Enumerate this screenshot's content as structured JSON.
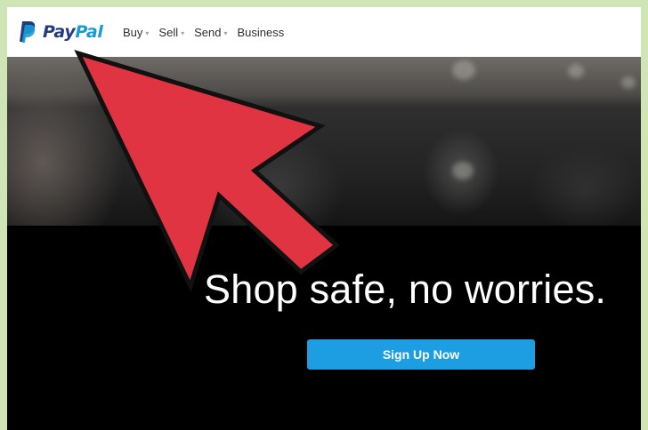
{
  "brand": {
    "logo_part1": "Pay",
    "logo_part2": "Pal",
    "logo_icon": "paypal-p-icon",
    "colors": {
      "pay": "#253b80",
      "pal": "#179bd7",
      "accent_button": "#1d9ee2",
      "annotation_arrow": "#e03442"
    }
  },
  "nav": {
    "items": [
      {
        "label": "Buy",
        "has_dropdown": true
      },
      {
        "label": "Sell",
        "has_dropdown": true
      },
      {
        "label": "Send",
        "has_dropdown": true
      },
      {
        "label": "Business",
        "has_dropdown": false
      }
    ],
    "dropdown_icon": "chevron-down-icon"
  },
  "hero": {
    "headline": "Shop safe, no worries.",
    "cta_label": "Sign Up Now"
  },
  "annotation": {
    "icon": "arrow-pointer-icon"
  }
}
